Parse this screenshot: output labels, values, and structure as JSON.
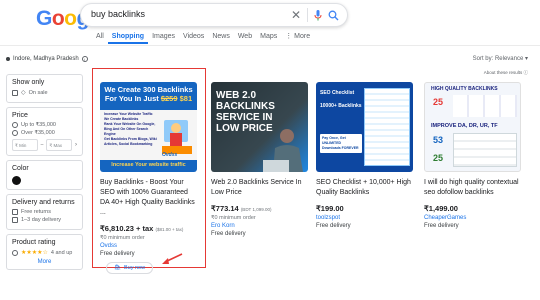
{
  "header": {
    "logo": [
      "G",
      "o",
      "o",
      "g",
      "l",
      "e"
    ],
    "logo_colors": [
      "#4285f4",
      "#ea4335",
      "#fbbc05",
      "#4285f4",
      "#34a853",
      "#ea4335"
    ],
    "query": "buy backlinks"
  },
  "tabs": [
    {
      "label": "All",
      "active": false
    },
    {
      "label": "Shopping",
      "active": true
    },
    {
      "label": "Images",
      "active": false
    },
    {
      "label": "Videos",
      "active": false
    },
    {
      "label": "News",
      "active": false
    },
    {
      "label": "Web",
      "active": false
    },
    {
      "label": "Maps",
      "active": false
    },
    {
      "label": "⋮ More",
      "active": false
    }
  ],
  "location": "Indore, Madhya Pradesh",
  "sort": "Sort by: Relevance ▾",
  "about": "About these results ⓘ",
  "sidebar": {
    "show_only": {
      "title": "Show only",
      "items": [
        "On sale"
      ]
    },
    "price": {
      "title": "Price",
      "items": [
        "Up to ₹35,000",
        "Over ₹35,000"
      ],
      "min_placeholder": "₹ Min",
      "max_placeholder": "₹ Max"
    },
    "color": {
      "title": "Color"
    },
    "delivery": {
      "title": "Delivery and returns",
      "items": [
        "Free returns",
        "1–3 day delivery"
      ]
    },
    "rating": {
      "title": "Product rating",
      "stars": "★★★★☆",
      "label": "4 and up",
      "more": "More"
    }
  },
  "products": [
    {
      "title": "Buy Backlinks - Boost Your SEO with 100% Guaranteed DA 40+ High Quality Backlinks ...",
      "price": "₹6,810.23 + tax",
      "old": "($81.00 + tax)",
      "sub": "₹0 minimum order",
      "store": "Ovdss",
      "ship": "Free delivery",
      "button": "Buy now",
      "img": {
        "banner": "We Create 300 Backlinks For You In Just",
        "strike": "$259",
        "price": "$81",
        "bullets": [
          "Increase Your Website Traffic",
          "We Create Backlinks",
          "Rank Your Website On Google, Bing And On Other Search Engine",
          "Get Backlinks From Blogs, Wiki Articles, Social Bookmarking"
        ],
        "footer": "Increase Your website traffic",
        "brand": "Ovdss"
      }
    },
    {
      "title": "Web 2.0 Backlinks Service In Low Price",
      "price": "₹773.14",
      "old": "(BDT 1,099.00)",
      "sub": "₹0 minimum order",
      "store": "Ero Korn",
      "ship": "Free delivery",
      "img": {
        "line1": "WEB 2.0",
        "line2": "BACKLINKS",
        "line3": "SERVICE IN",
        "line4": "LOW PRICE"
      }
    },
    {
      "title": "SEO Checklist + 10,000+ High Quality Backlinks",
      "price": "₹199.00",
      "store": "toolzspot",
      "ship": "Free delivery",
      "img": {
        "line1": "SEO Checklist",
        "line2": "10000+ Backlinks",
        "line3": "Pay Once, Get UNLIMITED Downloads FOREVER"
      }
    },
    {
      "title": "I will do high quality contextual seo dofollow backlinks",
      "price": "₹1,499.00",
      "store": "CheaperGames",
      "ship": "Free delivery",
      "img": {
        "line1": "HIGH QUALITY BACKLINKS",
        "line2": "IMPROVE DA, DR, UR, TF",
        "n1": "25",
        "n2": "53",
        "n3": "25"
      }
    }
  ]
}
